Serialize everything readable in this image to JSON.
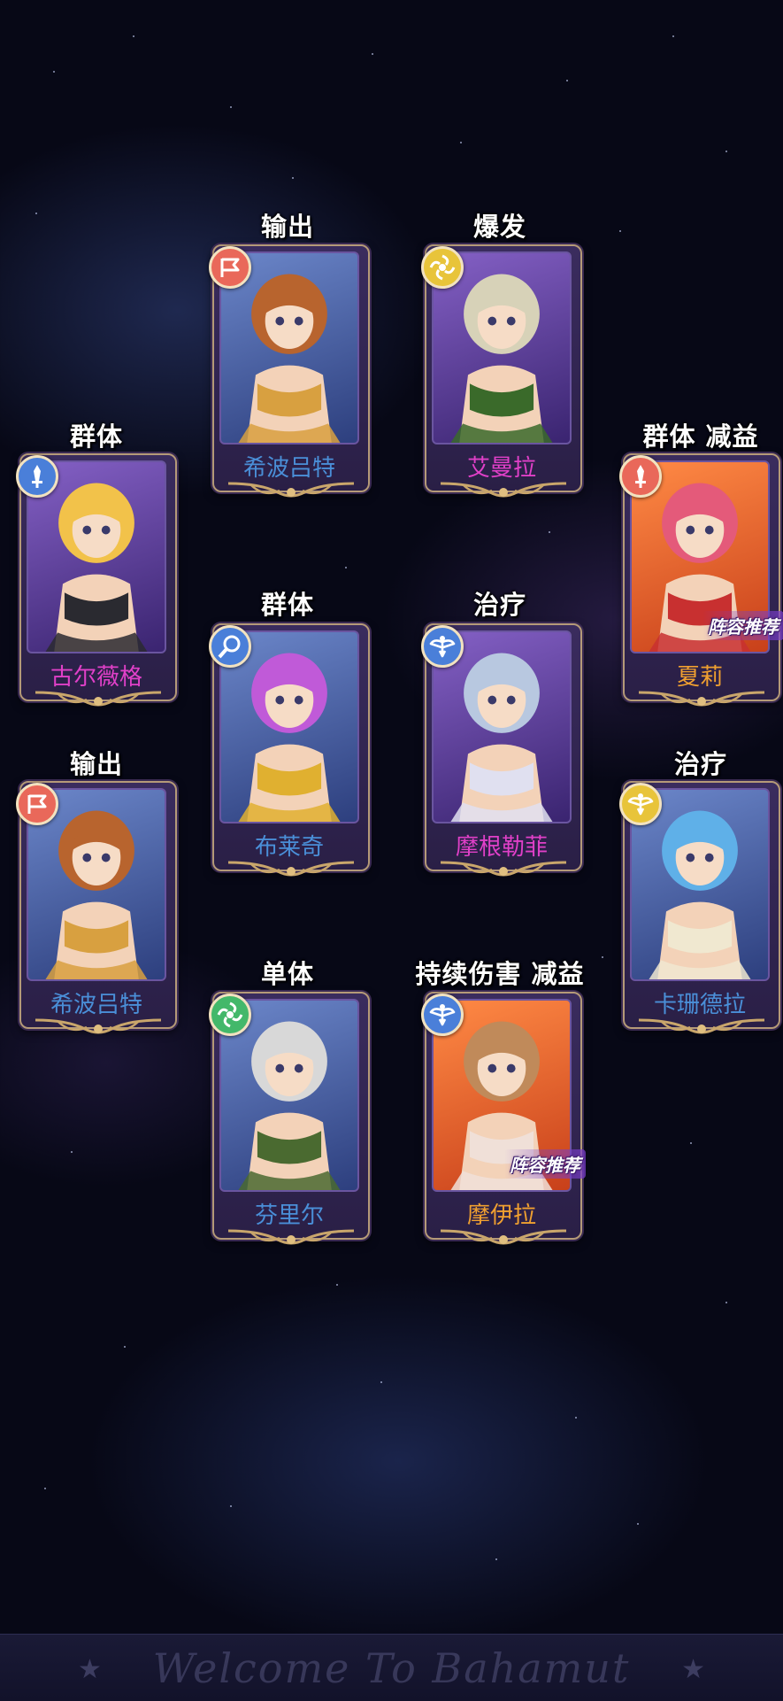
{
  "cards": [
    {
      "id": "c1",
      "tags": "输出",
      "name": "希波吕特",
      "name_color": "#4a8fd8",
      "bg": "bg-blue",
      "badge": "b-red",
      "badge_icon": "flag-icon",
      "recommend": ""
    },
    {
      "id": "c2",
      "tags": "爆发",
      "name": "艾曼拉",
      "name_color": "#e040c8",
      "bg": "bg-purple",
      "badge": "b-yellow",
      "badge_icon": "swirl-icon",
      "recommend": ""
    },
    {
      "id": "c3",
      "tags": "群体",
      "name": "古尔薇格",
      "name_color": "#e040c8",
      "bg": "bg-purple",
      "badge": "b-blue",
      "badge_icon": "dagger-icon",
      "recommend": ""
    },
    {
      "id": "c4",
      "tags": "群体  减益",
      "name": "夏莉",
      "name_color": "#f0a030",
      "bg": "bg-orange",
      "badge": "b-red",
      "badge_icon": "dagger-icon",
      "recommend": "阵容推荐"
    },
    {
      "id": "c5",
      "tags": "群体",
      "name": "布莱奇",
      "name_color": "#4a8fd8",
      "bg": "bg-blue",
      "badge": "b-blue",
      "badge_icon": "magnifier-icon",
      "recommend": ""
    },
    {
      "id": "c6",
      "tags": "治疗",
      "name": "摩根勒菲",
      "name_color": "#e040c8",
      "bg": "bg-purple",
      "badge": "b-blue",
      "badge_icon": "wings-icon",
      "recommend": ""
    },
    {
      "id": "c7",
      "tags": "输出",
      "name": "希波吕特",
      "name_color": "#4a8fd8",
      "bg": "bg-blue",
      "badge": "b-red",
      "badge_icon": "flag-icon",
      "recommend": ""
    },
    {
      "id": "c8",
      "tags": "治疗",
      "name": "卡珊德拉",
      "name_color": "#4a8fd8",
      "bg": "bg-blue",
      "badge": "b-yellow",
      "badge_icon": "wings-icon",
      "recommend": ""
    },
    {
      "id": "c9",
      "tags": "单体",
      "name": "芬里尔",
      "name_color": "#4a8fd8",
      "bg": "bg-blue",
      "badge": "b-green",
      "badge_icon": "swirl-icon",
      "recommend": ""
    },
    {
      "id": "c10",
      "tags": "持续伤害  减益",
      "name": "摩伊拉",
      "name_color": "#f0a030",
      "bg": "bg-orange",
      "badge": "b-blue",
      "badge_icon": "wings-icon",
      "recommend": "阵容推荐"
    }
  ],
  "banner": {
    "text": "Welcome To Bahamut"
  }
}
